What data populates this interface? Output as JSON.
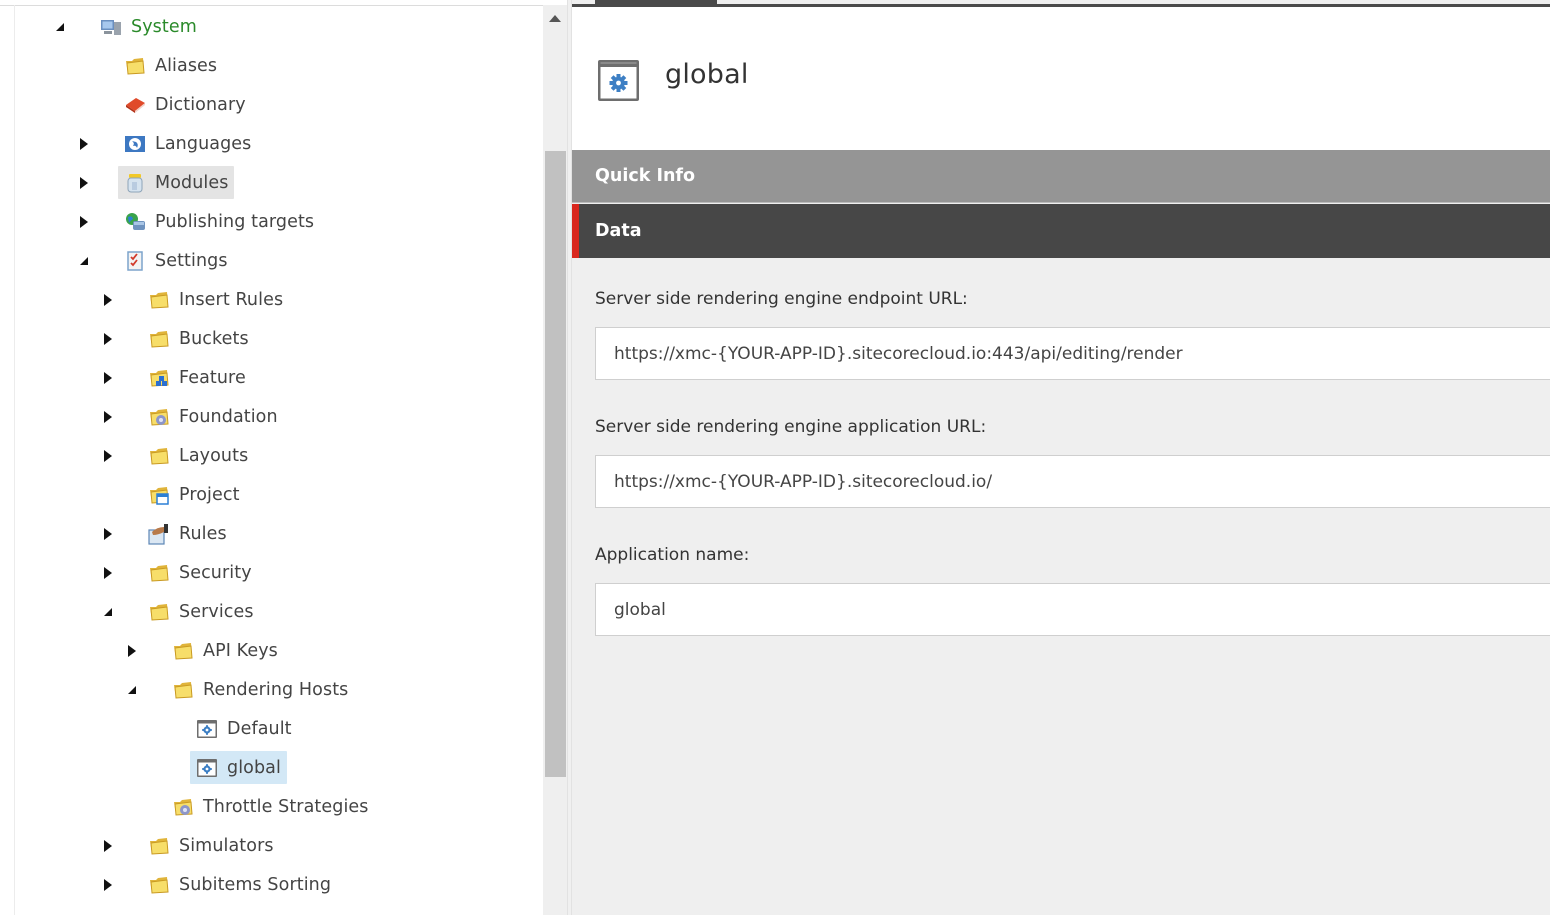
{
  "tree": {
    "items": [
      {
        "label": "System",
        "icon": "system-computer-icon",
        "toggle": "expanded",
        "level": 0,
        "root": true
      },
      {
        "label": "Aliases",
        "icon": "folder-icon",
        "toggle": "none",
        "level": 1
      },
      {
        "label": "Dictionary",
        "icon": "dictionary-book-icon",
        "toggle": "none",
        "level": 1
      },
      {
        "label": "Languages",
        "icon": "globe-flag-icon",
        "toggle": "collapsed",
        "level": 1
      },
      {
        "label": "Modules",
        "icon": "jar-icon",
        "toggle": "collapsed",
        "level": 1,
        "state": "hover"
      },
      {
        "label": "Publishing targets",
        "icon": "globe-database-icon",
        "toggle": "collapsed",
        "level": 1
      },
      {
        "label": "Settings",
        "icon": "checklist-icon",
        "toggle": "expanded",
        "level": 1
      },
      {
        "label": "Insert Rules",
        "icon": "folder-icon",
        "toggle": "collapsed",
        "level": 2
      },
      {
        "label": "Buckets",
        "icon": "folder-icon",
        "toggle": "collapsed",
        "level": 2
      },
      {
        "label": "Feature",
        "icon": "folder-blocks-icon",
        "toggle": "collapsed",
        "level": 2
      },
      {
        "label": "Foundation",
        "icon": "folder-gear-icon",
        "toggle": "collapsed",
        "level": 2
      },
      {
        "label": "Layouts",
        "icon": "folder-icon",
        "toggle": "collapsed",
        "level": 2
      },
      {
        "label": "Project",
        "icon": "folder-window-icon",
        "toggle": "none",
        "level": 2
      },
      {
        "label": "Rules",
        "icon": "rules-handshake-icon",
        "toggle": "collapsed",
        "level": 2
      },
      {
        "label": "Security",
        "icon": "folder-icon",
        "toggle": "collapsed",
        "level": 2
      },
      {
        "label": "Services",
        "icon": "folder-icon",
        "toggle": "expanded",
        "level": 2
      },
      {
        "label": "API Keys",
        "icon": "folder-icon",
        "toggle": "collapsed",
        "level": 3
      },
      {
        "label": "Rendering Hosts",
        "icon": "folder-icon",
        "toggle": "expanded",
        "level": 3
      },
      {
        "label": "Default",
        "icon": "window-gear-icon",
        "toggle": "none",
        "level": 4
      },
      {
        "label": "global",
        "icon": "window-gear-icon",
        "toggle": "none",
        "level": 4,
        "state": "selected"
      },
      {
        "label": "Throttle Strategies",
        "icon": "folder-gear-icon",
        "toggle": "none",
        "level": 3
      },
      {
        "label": "Simulators",
        "icon": "folder-icon",
        "toggle": "collapsed",
        "level": 2
      },
      {
        "label": "Subitems Sorting",
        "icon": "folder-icon",
        "toggle": "collapsed",
        "level": 2
      },
      {
        "label": "",
        "icon": "folder-icon",
        "toggle": "none",
        "level": 2
      }
    ]
  },
  "scrollbar": {
    "position_fraction": 0.16,
    "visible_fraction": 0.69
  },
  "item": {
    "title": "global",
    "icon": "window-gear-icon"
  },
  "sections": {
    "quick_info": "Quick Info",
    "data": "Data"
  },
  "fields": [
    {
      "label": "Server side rendering engine endpoint URL:",
      "value": "https://xmc-{YOUR-APP-ID}.sitecorecloud.io:443/api/editing/render"
    },
    {
      "label": "Server side rendering engine application URL:",
      "value": "https://xmc-{YOUR-APP-ID}.sitecorecloud.io/"
    },
    {
      "label": "Application name:",
      "value": "global"
    }
  ],
  "colors": {
    "root_label": "#2a8a2a",
    "selected_bg": "#d3e8f6",
    "hover_bg": "#e4e4e4",
    "quick_info_bg": "#959595",
    "data_bg": "#474747",
    "data_accent": "#d9271e",
    "icon_blue": "#3d7fc4"
  }
}
